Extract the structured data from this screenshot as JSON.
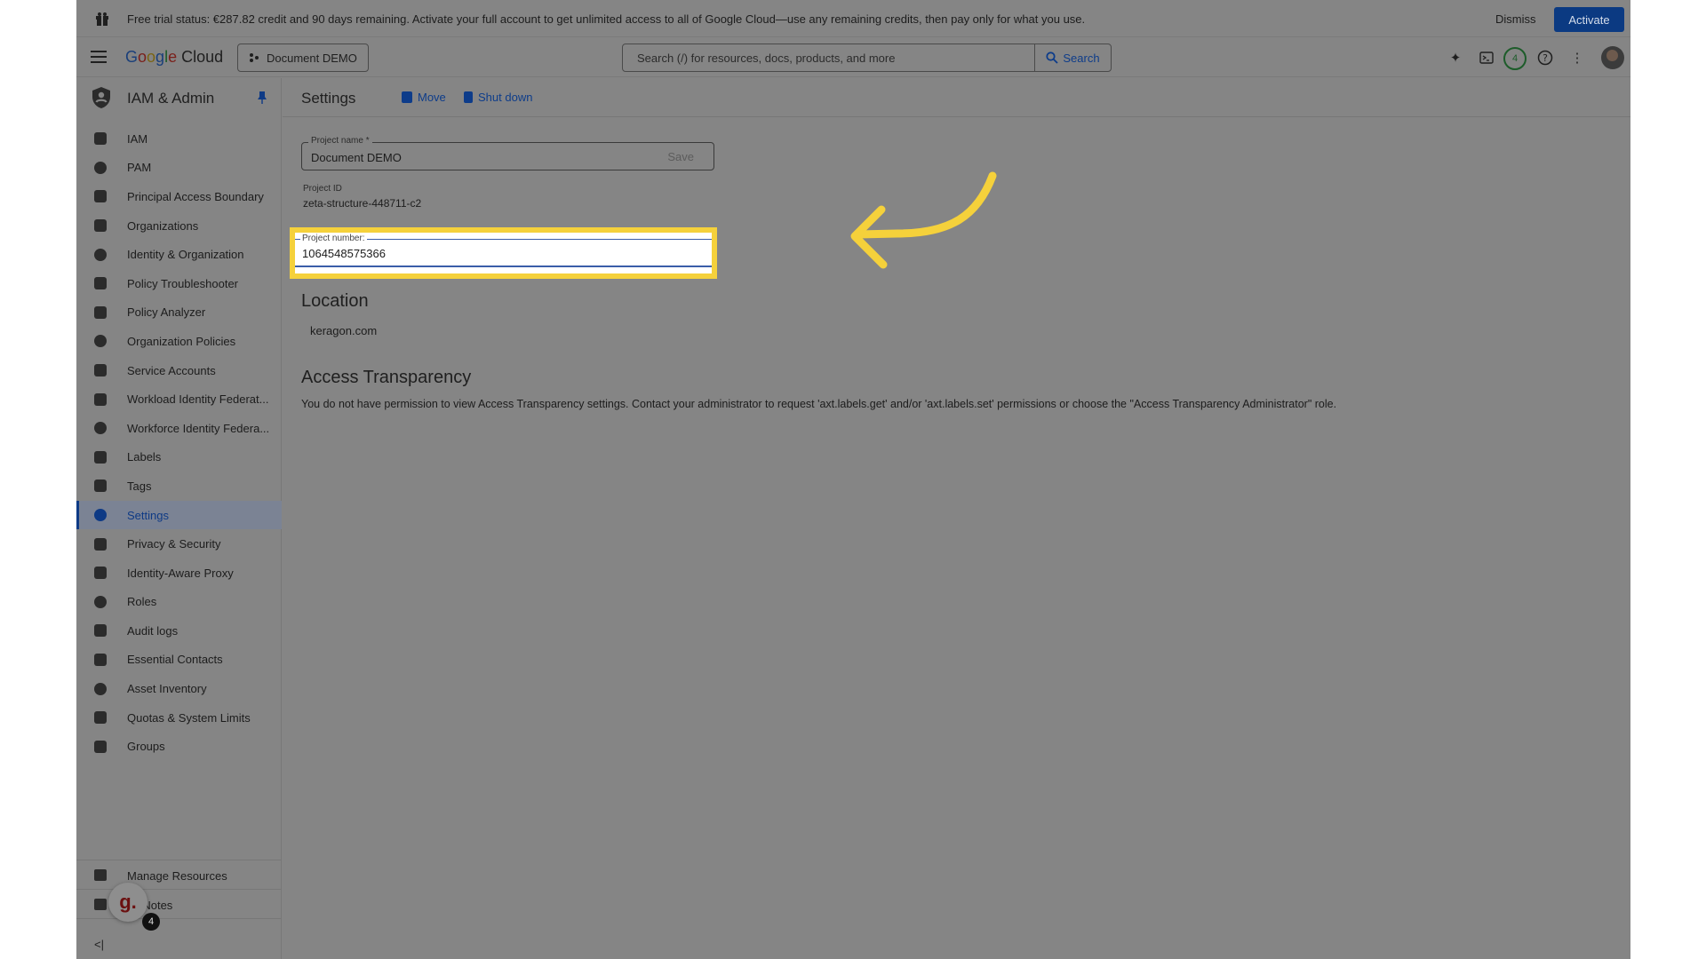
{
  "banner": {
    "message": "Free trial status: €287.82 credit and 90 days remaining. Activate your full account to get unlimited access to all of Google Cloud—use any remaining credits, then pay only for what you use.",
    "dismiss_label": "Dismiss",
    "activate_label": "Activate"
  },
  "header": {
    "logo_google": [
      "G",
      "o",
      "o",
      "g",
      "l",
      "e"
    ],
    "logo_cloud": "Cloud",
    "project_selector": "Document DEMO",
    "search_placeholder": "Search (/) for resources, docs, products, and more",
    "search_button": "Search",
    "notification_count": "4",
    "icons": [
      "gemini-icon",
      "cloud-shell-icon",
      "help-icon",
      "more-vert-icon"
    ]
  },
  "sidebar": {
    "title": "IAM & Admin",
    "items": [
      {
        "label": "IAM",
        "icon": "person-add-icon"
      },
      {
        "label": "PAM",
        "icon": "shield-icon"
      },
      {
        "label": "Principal Access Boundary",
        "icon": "boundary-icon"
      },
      {
        "label": "Organizations",
        "icon": "building-icon"
      },
      {
        "label": "Identity & Organization",
        "icon": "account-circle-icon"
      },
      {
        "label": "Policy Troubleshooter",
        "icon": "wrench-icon"
      },
      {
        "label": "Policy Analyzer",
        "icon": "doc-search-icon"
      },
      {
        "label": "Organization Policies",
        "icon": "policy-doc-icon"
      },
      {
        "label": "Service Accounts",
        "icon": "service-account-icon"
      },
      {
        "label": "Workload Identity Federat...",
        "icon": "workload-icon"
      },
      {
        "label": "Workforce Identity Federa...",
        "icon": "list-icon"
      },
      {
        "label": "Labels",
        "icon": "label-icon"
      },
      {
        "label": "Tags",
        "icon": "tag-icon"
      },
      {
        "label": "Settings",
        "icon": "settings-icon",
        "active": true
      },
      {
        "label": "Privacy & Security",
        "icon": "privacy-shield-icon"
      },
      {
        "label": "Identity-Aware Proxy",
        "icon": "proxy-icon"
      },
      {
        "label": "Roles",
        "icon": "roles-icon"
      },
      {
        "label": "Audit logs",
        "icon": "audit-list-icon"
      },
      {
        "label": "Essential Contacts",
        "icon": "contacts-icon"
      },
      {
        "label": "Asset Inventory",
        "icon": "inventory-icon"
      },
      {
        "label": "Quotas & System Limits",
        "icon": "quota-icon"
      },
      {
        "label": "Groups",
        "icon": "groups-icon"
      }
    ],
    "footer": {
      "manage_resources": "Manage Resources",
      "release_notes": "se Notes"
    },
    "collapse_glyph": "<|",
    "bubble_letter": "g.",
    "bubble_count": "4"
  },
  "main": {
    "page_title": "Settings",
    "move_label": "Move",
    "shutdown_label": "Shut down",
    "project_name_label": "Project name *",
    "project_name_value": "Document DEMO",
    "save_label": "Save",
    "project_id_label": "Project ID",
    "project_id_value": "zeta-structure-448711-c2",
    "project_number_label": "Project number:",
    "project_number_value": "1064548575366",
    "location_title": "Location",
    "location_value": "keragon.com",
    "access_title": "Access Transparency",
    "access_text": "You do not have permission to view Access Transparency settings. Contact your administrator to request 'axt.labels.get' and/or 'axt.labels.set' permissions or choose the \"Access Transparency Administrator\" role."
  },
  "colors": {
    "overlay_gray": "#858585",
    "highlight": "#f5d13b",
    "arrow": "#f5d13b",
    "link_blue": "#0d3c8a"
  }
}
